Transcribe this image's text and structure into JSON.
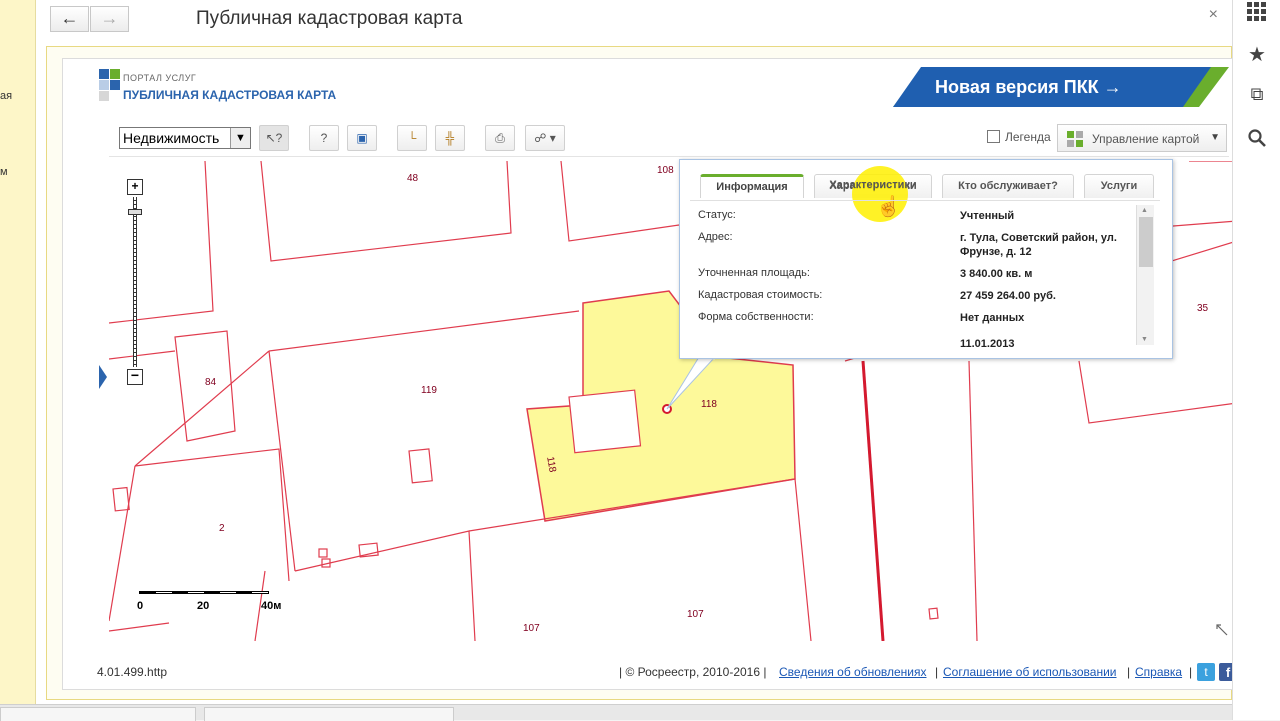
{
  "window": {
    "title": "Публичная кадастровая карта",
    "back_icon": "arrow-left-icon",
    "forward_icon": "arrow-right-icon",
    "close_icon": "close-icon",
    "left_strip_texts": [
      "ая",
      "м"
    ]
  },
  "portal": {
    "logo_small": "ПОРТАЛ УСЛУГ",
    "logo_title": "ПУБЛИЧНАЯ КАДАСТРОВАЯ КАРТА",
    "new_version_label": "Новая версия ПКК →",
    "accent_blue": "#1f5fb0",
    "accent_green": "#5fa82a"
  },
  "toolbar": {
    "select_value": "Недвижимость",
    "legend_label": "Легенда",
    "map_control_label": "Управление картой",
    "tools": [
      "pointer-icon",
      "identify-icon",
      "info-icon",
      "measure-icon",
      "area-measure-icon",
      "print-icon",
      "link-icon"
    ]
  },
  "map": {
    "parcel_labels": [
      "48",
      "108",
      "84",
      "119",
      "118",
      "118",
      "2",
      "107",
      "107",
      "35"
    ],
    "scale_labels": [
      "0",
      "20",
      "40м"
    ],
    "highlight_color": "#fdf99a",
    "boundary_color": "#e03c4e"
  },
  "popup": {
    "tabs": [
      "Информация",
      "Характеристики",
      "Кто обслуживает?",
      "Услуги"
    ],
    "active_tab": "Информация",
    "rows": [
      {
        "label": "Статус:",
        "value": "Учтенный"
      },
      {
        "label": "Адрес:",
        "value": "г. Тула, Советский район, ул. Фрунзе, д. 12"
      },
      {
        "label": "Уточненная площадь:",
        "value": "3 840.00 кв. м"
      },
      {
        "label": "Кадастровая стоимость:",
        "value": "27 459 264.00 руб."
      },
      {
        "label": "Форма собственности:",
        "value": "Нет данных"
      }
    ],
    "partial_row": "11.01.2013"
  },
  "footer": {
    "version": "4.01.499.http",
    "copyright": "| © Росреестр, 2010-2016 |",
    "link_updates": "Сведения об обновлениях",
    "link_agreement": "Соглашение об использовании",
    "link_help": "Справка",
    "sep": "|"
  },
  "right_strip": {
    "icons": [
      "apps-icon",
      "star-icon",
      "copy-icon",
      "search-icon"
    ]
  }
}
